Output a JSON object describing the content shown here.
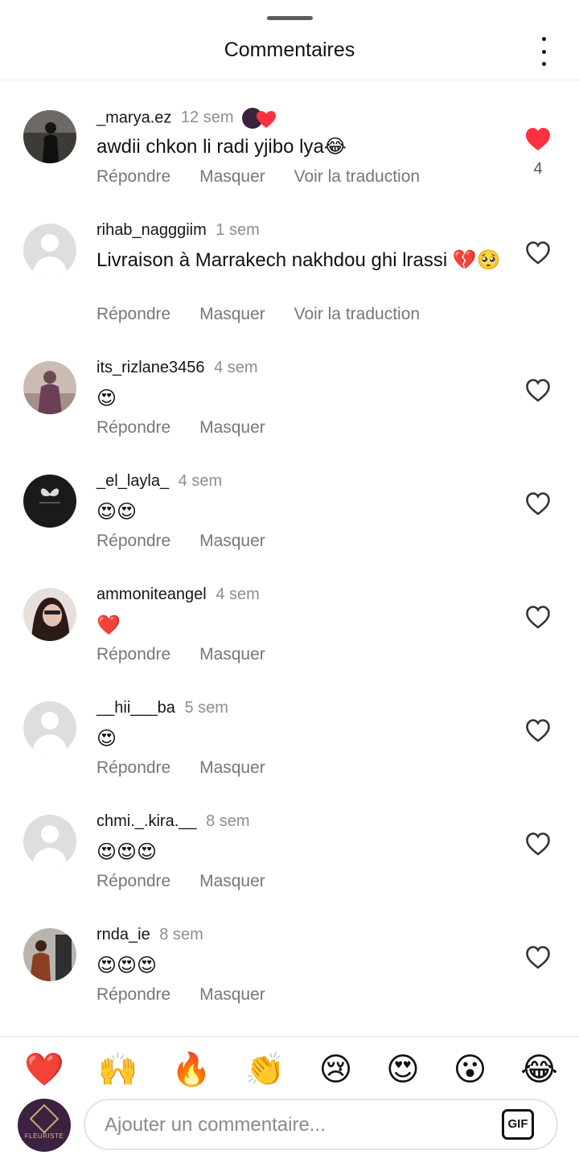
{
  "header": {
    "title": "Commentaires"
  },
  "action_labels": {
    "reply": "Répondre",
    "hide": "Masquer",
    "translate": "Voir la traduction"
  },
  "comments": [
    {
      "username": "_marya.ez",
      "time": "12 sem",
      "text": "awdii chkon li radi yjibo lya😂",
      "liked": true,
      "like_count": "4",
      "has_story_reaction": true
    },
    {
      "username": "rihab_nagggiim",
      "time": "1 sem",
      "text": "Livraison à Marrakech nakhdou ghi lrassi 💔🥺",
      "liked": false
    },
    {
      "username": "its_rizlane3456",
      "time": "4 sem",
      "text": "😍",
      "liked": false
    },
    {
      "username": "_el_layla_",
      "time": "4 sem",
      "text": "😍😍",
      "liked": false
    },
    {
      "username": "ammoniteangel",
      "time": "4 sem",
      "text": "❤️",
      "liked": false
    },
    {
      "username": "__hii___ba",
      "time": "5 sem",
      "text": "😍",
      "liked": false
    },
    {
      "username": "chmi._.kira.__",
      "time": "8 sem",
      "text": "😍😍😍",
      "liked": false
    },
    {
      "username": "rnda_ie",
      "time": "8 sem",
      "text": "😍😍😍",
      "liked": false
    }
  ],
  "quick_reactions": [
    "❤️",
    "🙌",
    "🔥",
    "👏",
    "😢",
    "😍",
    "😮",
    "😂"
  ],
  "composer": {
    "placeholder": "Ajouter un commentaire...",
    "gif_label": "GIF",
    "avatar_brand": "FLEURISTE"
  },
  "colors": {
    "like_red": "#ff3040",
    "secondary_text": "#8e8e8e"
  }
}
